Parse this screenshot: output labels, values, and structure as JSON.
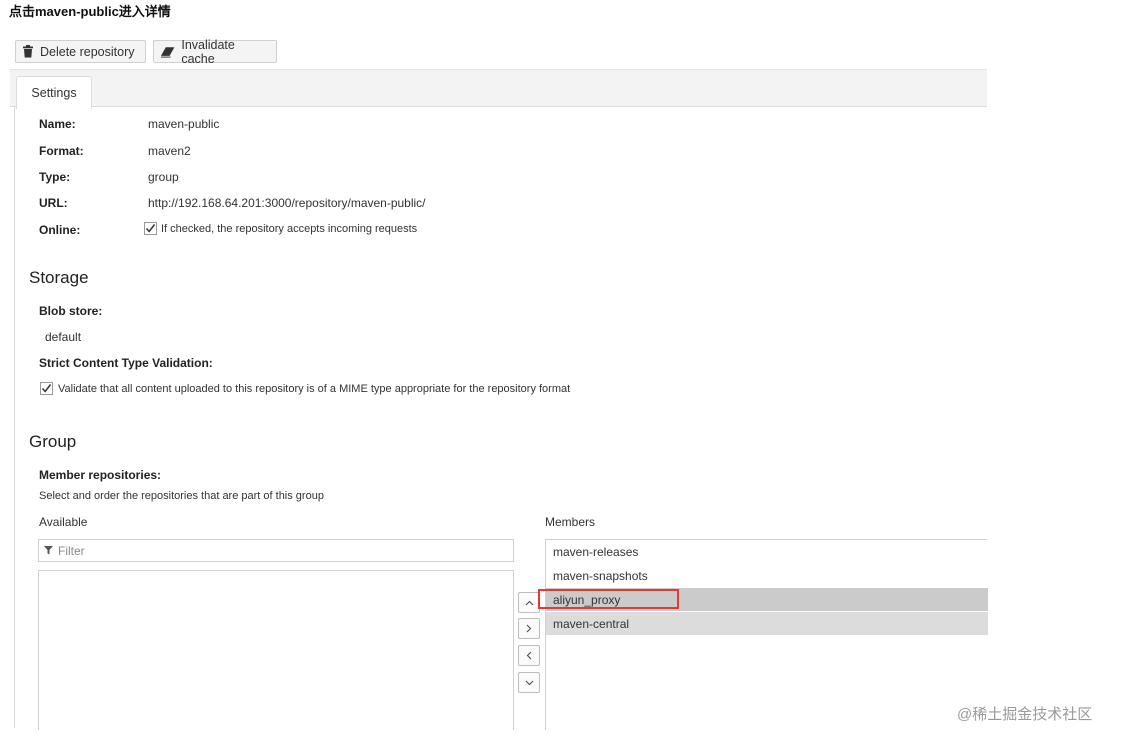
{
  "caption": "点击maven-public进入详情",
  "toolbar": {
    "delete_label": "Delete repository",
    "delete_icon": "trash-icon",
    "invalidate_label": "Invalidate cache",
    "invalidate_icon": "eraser-icon"
  },
  "tabs": [
    {
      "label": "Settings",
      "active": true
    }
  ],
  "settings": {
    "name_label": "Name:",
    "name_value": "maven-public",
    "format_label": "Format:",
    "format_value": "maven2",
    "type_label": "Type:",
    "type_value": "group",
    "url_label": "URL:",
    "url_value": "http://192.168.64.201:3000/repository/maven-public/",
    "online_label": "Online:",
    "online_checked": true,
    "online_text": "If checked, the repository accepts incoming requests"
  },
  "storage": {
    "heading": "Storage",
    "blob_label": "Blob store:",
    "blob_value": "default",
    "strict_label": "Strict Content Type Validation:",
    "strict_checked": true,
    "strict_text": "Validate that all content uploaded to this repository is of a MIME type appropriate for the repository format"
  },
  "group": {
    "heading": "Group",
    "members_label": "Member repositories:",
    "description": "Select and order the repositories that are part of this group",
    "available_label": "Available",
    "members_header": "Members",
    "filter_placeholder": "Filter",
    "available_items": [],
    "members": [
      "maven-releases",
      "maven-snapshots",
      "aliyun_proxy",
      "maven-central"
    ],
    "selected_members": [
      "aliyun_proxy",
      "maven-central"
    ],
    "highlighted_member": "aliyun_proxy"
  },
  "watermark": "@稀土掘金技术社区",
  "colors": {
    "highlight_box": "#e53935",
    "selected_row": "#cbcbcb"
  }
}
